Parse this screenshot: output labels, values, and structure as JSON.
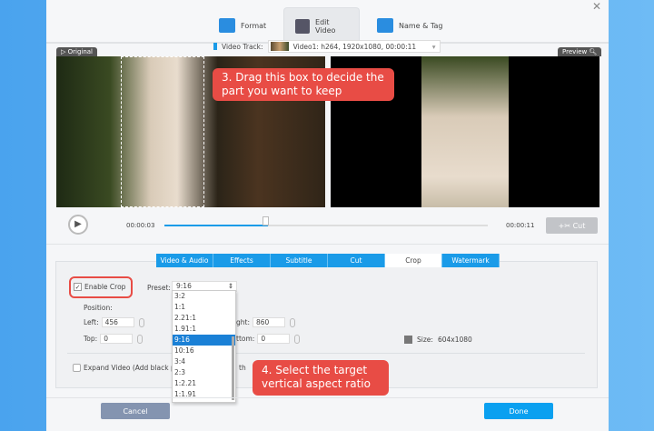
{
  "tabs": [
    {
      "label": "Format",
      "icon": "format-icon"
    },
    {
      "label": "Edit Video",
      "icon": "edit-video-icon"
    },
    {
      "label": "Name & Tag",
      "icon": "name-tag-icon"
    }
  ],
  "video_track": {
    "label": "Video Track:",
    "value": "Video1: h264, 1920x1080, 00:00:11"
  },
  "original_label": "Original",
  "preview_label": "Preview",
  "callout3": "3. Drag this box to decide the part you want to keep",
  "callout4": "4. Select the target vertical aspect ratio",
  "player": {
    "current": "00:00:03",
    "total": "00:00:11",
    "progress": 0.32,
    "cut_label": "Cut"
  },
  "edit_tabs": [
    "Video & Audio",
    "Effects",
    "Subtitle",
    "Cut",
    "Crop",
    "Watermark"
  ],
  "crop": {
    "enable_label": "Enable Crop",
    "enabled": true,
    "preset_label": "Preset:",
    "preset_value": "9:16",
    "position_label": "Position:",
    "left_label": "Left:",
    "left": "456",
    "top_label": "Top:",
    "top": "0",
    "right_label": "ght:",
    "right": "860",
    "bottom_label": "ttom:",
    "bottom": "0",
    "size_label": "Size:",
    "size": "604x1080",
    "expand_label": "Expand Video (Add black pa",
    "expand_tail": "th"
  },
  "preset_options": [
    "3:2",
    "1:1",
    "2.21:1",
    "1.91:1",
    "9:16",
    "10:16",
    "3:4",
    "2:3",
    "1:2.21",
    "1:1.91"
  ],
  "buttons": {
    "cancel": "Cancel",
    "done": "Done"
  }
}
